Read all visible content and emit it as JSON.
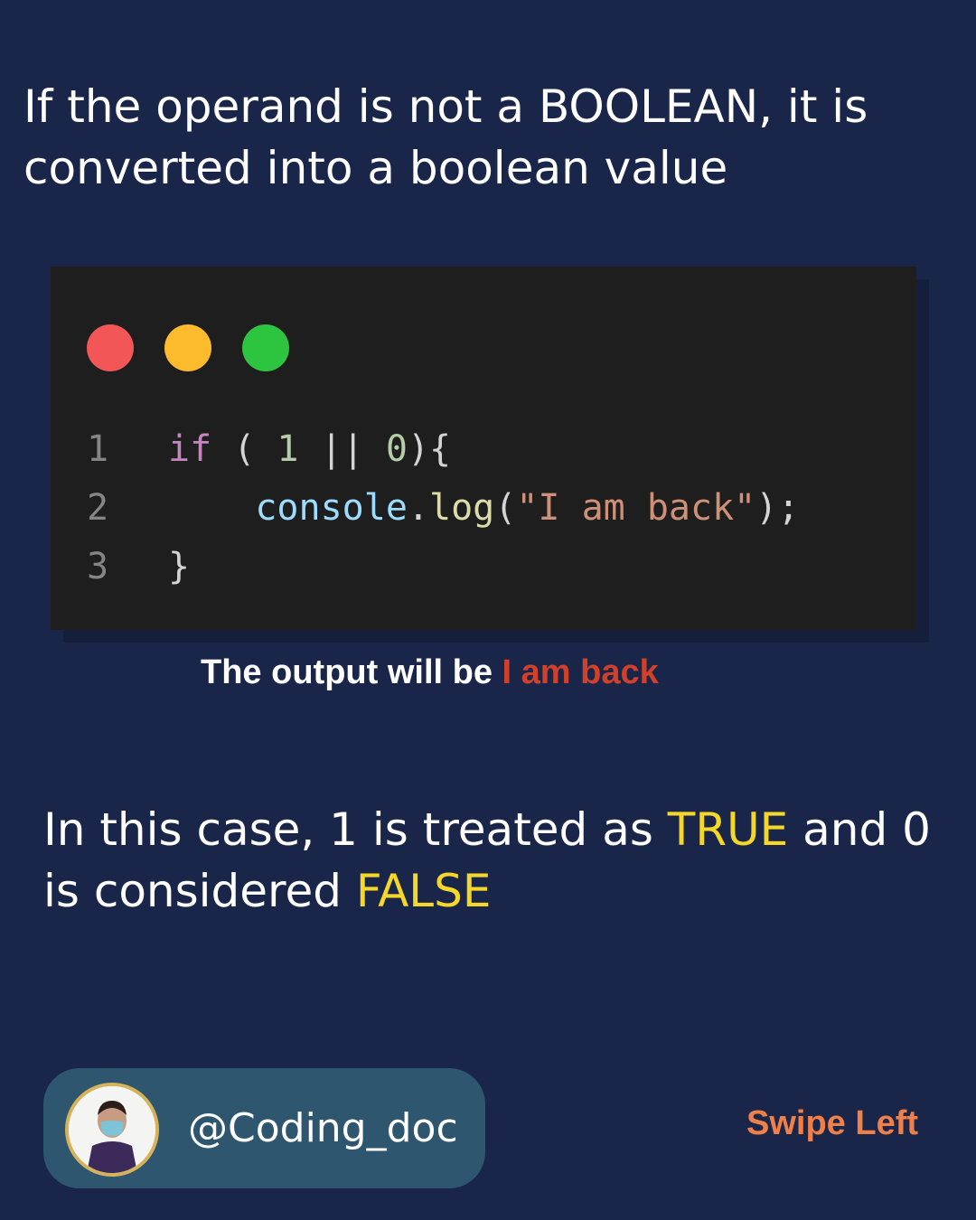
{
  "heading": "If the operand is not a BOOLEAN, it is converted into a boolean value",
  "code_window": {
    "window_dots": [
      {
        "name": "close-dot",
        "color": "#f25656"
      },
      {
        "name": "minimize-dot",
        "color": "#fcbb2c"
      },
      {
        "name": "maximize-dot",
        "color": "#2dc53f"
      }
    ],
    "lines": [
      {
        "number": "1",
        "tokens": [
          {
            "text": "if",
            "class": "kw"
          },
          {
            "text": " ( ",
            "class": "punc"
          },
          {
            "text": "1",
            "class": "num"
          },
          {
            "text": " || ",
            "class": "punc"
          },
          {
            "text": "0",
            "class": "num"
          },
          {
            "text": "){",
            "class": "punc"
          }
        ]
      },
      {
        "number": "2",
        "tokens": [
          {
            "text": "    ",
            "class": "punc"
          },
          {
            "text": "console",
            "class": "obj"
          },
          {
            "text": ".",
            "class": "punc"
          },
          {
            "text": "log",
            "class": "fn"
          },
          {
            "text": "(",
            "class": "punc"
          },
          {
            "text": "\"I am back\"",
            "class": "str"
          },
          {
            "text": ");",
            "class": "punc"
          }
        ]
      },
      {
        "number": "3",
        "tokens": [
          {
            "text": "}",
            "class": "punc"
          }
        ]
      }
    ]
  },
  "output": {
    "prefix": "The output will be ",
    "value": "I am back"
  },
  "explanation": {
    "part1": "In this case, 1 is treated as ",
    "true_word": "TRUE",
    "part2": " and 0 is considered ",
    "false_word": "FALSE"
  },
  "profile": {
    "avatar_icon": "user-photo-avatar-icon",
    "handle": "@Coding_doc"
  },
  "swipe_label": "Swipe Left",
  "colors": {
    "background": "#1a2649",
    "output_highlight": "#d0402b",
    "keyword_highlight": "#f5d72a",
    "swipe": "#f08049",
    "profile_pill": "#2e566e"
  }
}
